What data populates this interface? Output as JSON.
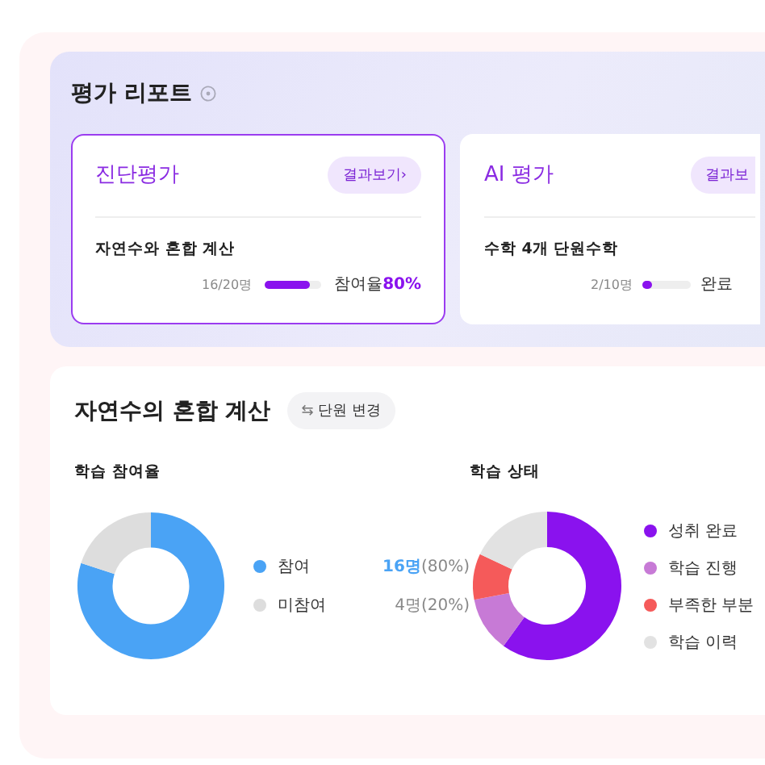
{
  "report": {
    "title": "평가 리포트",
    "cards": [
      {
        "title": "진단평가",
        "button": "결과보기",
        "arrow": "›",
        "selected": true,
        "subject": "자연수와 혼합 계산",
        "count": "16/20명",
        "level": 0.8,
        "rate_label": "참여율",
        "rate": "80%"
      },
      {
        "title": "AI 평가",
        "button": "결과보",
        "selected": false,
        "subject": "수학 4개 단원수학",
        "count": "2/10명",
        "level": 0.2,
        "rate_label": "완료"
      }
    ]
  },
  "unit": {
    "title": "자연수의 혼합 계산",
    "change_icon": "⇆",
    "change_button": "단원 변경",
    "participation": {
      "title": "학습 참여율",
      "chart_data": {
        "type": "donut",
        "categories": [
          "참여",
          "미참여"
        ],
        "values": [
          80,
          20
        ]
      },
      "legend": [
        {
          "count": "16명",
          "percent": "(80%)",
          "highlight": true,
          "color": "#4aa3f5"
        },
        {
          "count": "4명",
          "percent": "(20%)",
          "highlight": false,
          "color": "#dddddd"
        }
      ]
    },
    "status": {
      "title": "학습 상태",
      "legend": [
        {
          "label": "성취 완료",
          "color": "#8a12ee"
        },
        {
          "label": "학습 진행",
          "color": "#c77ad6"
        },
        {
          "label": "부족한 부분",
          "color": "#f55a5a"
        },
        {
          "label": "학습 이력",
          "color": "#e2e2e2"
        }
      ]
    }
  }
}
